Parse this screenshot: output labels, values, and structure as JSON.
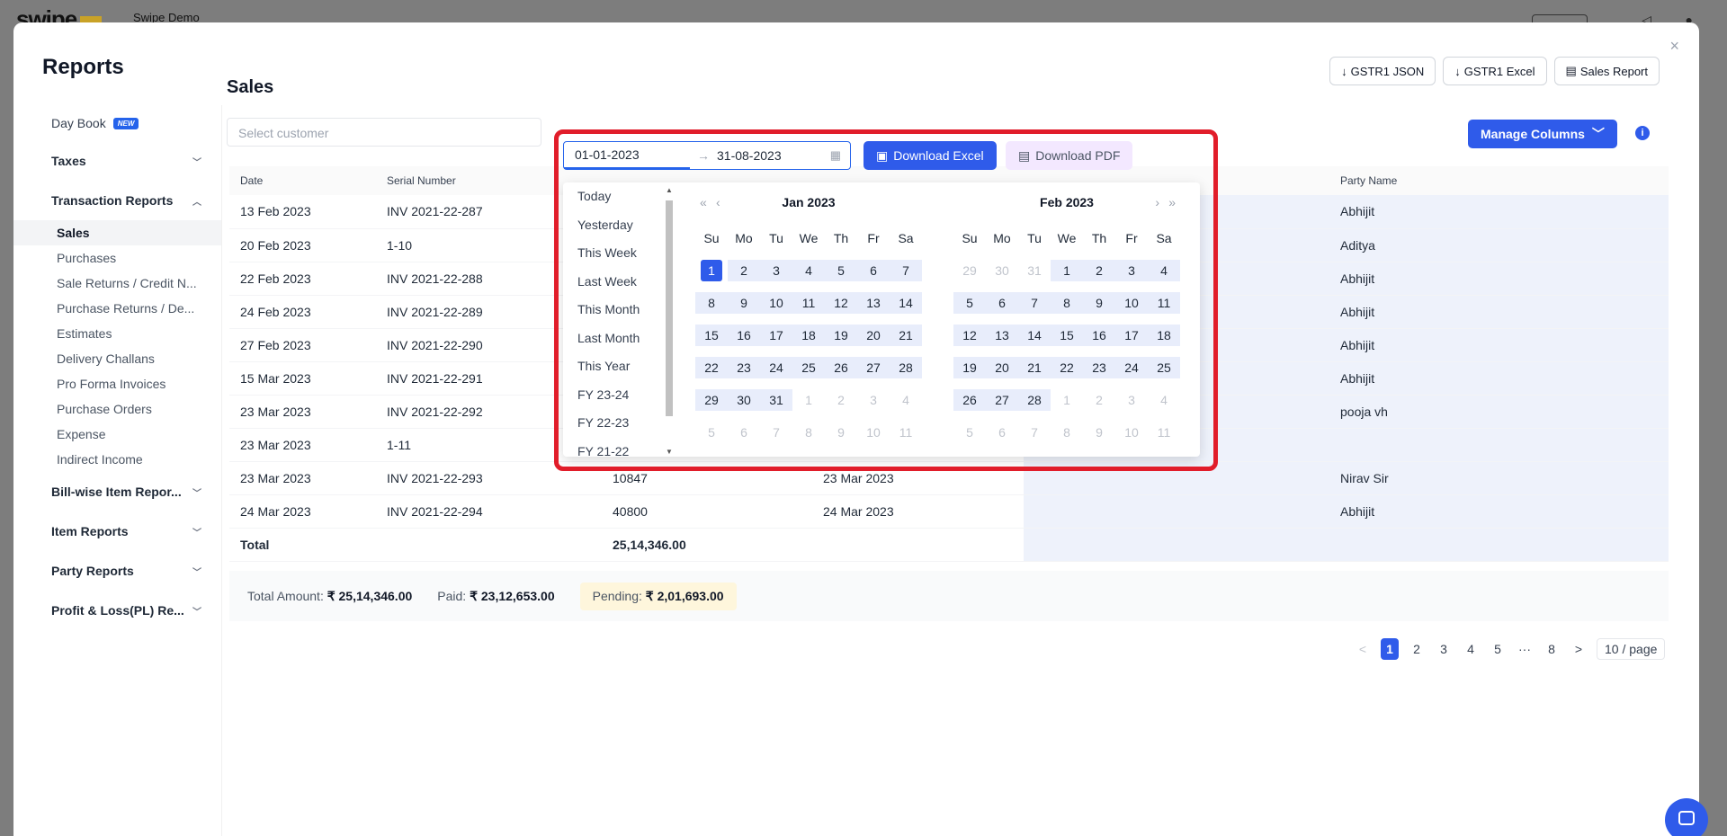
{
  "app": {
    "logo": "swipe",
    "company": "Swipe Demo"
  },
  "modal": {
    "title": "Reports",
    "close": "×",
    "actions": [
      {
        "label": "GSTR1 JSON",
        "icon": "download-icon"
      },
      {
        "label": "GSTR1 Excel",
        "icon": "download-icon"
      },
      {
        "label": "Sales Report",
        "icon": "document-icon"
      }
    ]
  },
  "sidebar": {
    "day_book": "Day Book",
    "new_badge": "NEW",
    "taxes": "Taxes",
    "transaction_reports": "Transaction Reports",
    "sub": [
      "Sales",
      "Purchases",
      "Sale Returns / Credit N...",
      "Purchase Returns / De...",
      "Estimates",
      "Delivery Challans",
      "Pro Forma Invoices",
      "Purchase Orders",
      "Expense",
      "Indirect Income"
    ],
    "bill_wise": "Bill-wise Item Repor...",
    "item_reports": "Item Reports",
    "party_reports": "Party Reports",
    "pl_reports": "Profit & Loss(PL) Re..."
  },
  "main": {
    "title": "Sales",
    "customer_placeholder": "Select customer",
    "manage_columns": "Manage Columns",
    "info": "i"
  },
  "date_picker": {
    "start": "01-01-2023",
    "end": "31-08-2023",
    "separator": "→",
    "presets": [
      "Today",
      "Yesterday",
      "This Week",
      "Last Week",
      "This Month",
      "Last Month",
      "This Year",
      "FY 23-24",
      "FY 22-23",
      "FY 21-22"
    ],
    "weekdays": [
      "Su",
      "Mo",
      "Tu",
      "We",
      "Th",
      "Fr",
      "Sa"
    ],
    "left_month": "Jan",
    "left_year": "2023",
    "right_month": "Feb",
    "right_year": "2023",
    "nav_prev_year": "«",
    "nav_prev": "‹",
    "nav_next": "›",
    "nav_next_year": "»"
  },
  "downloads": {
    "excel": "Download Excel",
    "pdf": "Download PDF"
  },
  "table": {
    "headers": [
      "Date",
      "Serial Number",
      "",
      "",
      "",
      "Party Name"
    ],
    "rows": [
      {
        "date": "13 Feb 2023",
        "serial": "INV 2021-22-287",
        "amount": "",
        "due": "",
        "party": "Abhijit"
      },
      {
        "date": "20 Feb 2023",
        "serial": "1-10",
        "amount": "",
        "due": "",
        "party": "Aditya"
      },
      {
        "date": "22 Feb 2023",
        "serial": "INV 2021-22-288",
        "amount": "",
        "due": "",
        "party": "Abhijit"
      },
      {
        "date": "24 Feb 2023",
        "serial": "INV 2021-22-289",
        "amount": "",
        "due": "",
        "party": "Abhijit"
      },
      {
        "date": "27 Feb 2023",
        "serial": "INV 2021-22-290",
        "amount": "",
        "due": "",
        "party": "Abhijit"
      },
      {
        "date": "15 Mar 2023",
        "serial": "INV 2021-22-291",
        "amount": "",
        "due": "",
        "party": "Abhijit"
      },
      {
        "date": "23 Mar 2023",
        "serial": "INV 2021-22-292",
        "amount": "",
        "due": "",
        "party": "pooja vh"
      },
      {
        "date": "23 Mar 2023",
        "serial": "1-11",
        "amount": "",
        "due": "",
        "party": ""
      },
      {
        "date": "23 Mar 2023",
        "serial": "INV 2021-22-293",
        "amount": "10847",
        "due": "23 Mar 2023",
        "party": "Nirav Sir"
      },
      {
        "date": "24 Mar 2023",
        "serial": "INV 2021-22-294",
        "amount": "40800",
        "due": "24 Mar 2023",
        "party": "Abhijit"
      }
    ],
    "total_label": "Total",
    "total_value": "25,14,346.00"
  },
  "summary": {
    "total_label": "Total Amount:",
    "total_value": "₹ 25,14,346.00",
    "paid_label": "Paid:",
    "paid_value": "₹ 23,12,653.00",
    "pending_label": "Pending:",
    "pending_value": "₹ 2,01,693.00"
  },
  "pagination": {
    "prev": "<",
    "pages": [
      "1",
      "2",
      "3",
      "4",
      "5"
    ],
    "ellipsis": "···",
    "last": "8",
    "next": ">",
    "page_size": "10 / page"
  },
  "colors": {
    "accent": "#2f5bea",
    "highlight_border": "#e11d2a",
    "pending_bg": "#fef6dc"
  }
}
